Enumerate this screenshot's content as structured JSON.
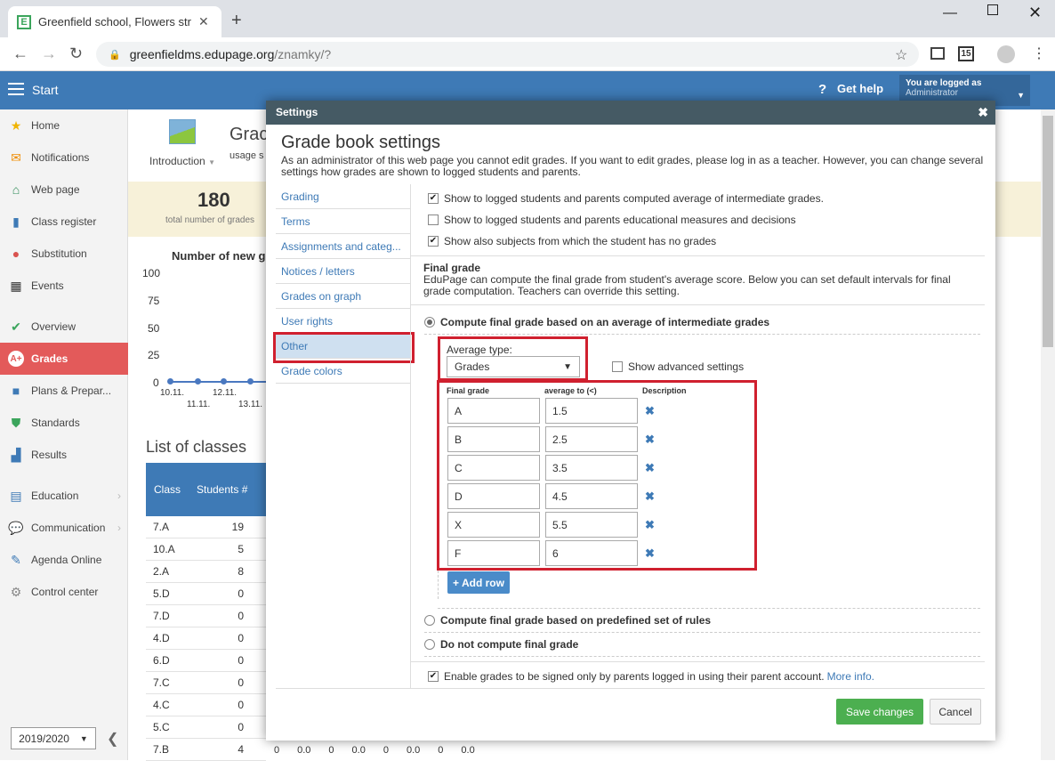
{
  "browser": {
    "tab_title": "Greenfield school, Flowers street",
    "favicon_letter": "E",
    "url_host": "greenfieldms.edupage.org",
    "url_path": "/znamky/?",
    "ext_badge": "15"
  },
  "header": {
    "start": "Start",
    "get_help": "Get help",
    "logged_as": "You are logged as",
    "user": "Administrator"
  },
  "sidebar": {
    "items": [
      {
        "label": "Home",
        "icon": "star-icon"
      },
      {
        "label": "Notifications",
        "icon": "envelope-icon"
      },
      {
        "label": "Web page",
        "icon": "house-icon"
      },
      {
        "label": "Class register",
        "icon": "book-icon"
      },
      {
        "label": "Substitution",
        "icon": "person-icon"
      },
      {
        "label": "Events",
        "icon": "calendar-icon"
      },
      {
        "label": "Overview",
        "icon": "check-icon"
      },
      {
        "label": "Grades",
        "icon": "grade-icon"
      },
      {
        "label": "Plans & Prepar...",
        "icon": "briefcase-icon"
      },
      {
        "label": "Standards",
        "icon": "shield-icon"
      },
      {
        "label": "Results",
        "icon": "bar-chart-icon"
      },
      {
        "label": "Education",
        "icon": "education-icon"
      },
      {
        "label": "Communication",
        "icon": "chat-icon"
      },
      {
        "label": "Agenda Online",
        "icon": "pencil-icon"
      },
      {
        "label": "Control center",
        "icon": "gear-icon"
      }
    ],
    "year": "2019/2020"
  },
  "background": {
    "intro_label": "Introduction",
    "page_title_partial": "Grac",
    "usage_partial": "usage s",
    "stat_value": "180",
    "stat_label": "total number of grades",
    "chart_title": "Number of new g",
    "y_ticks": [
      "100",
      "75",
      "50",
      "25",
      "0"
    ],
    "x_ticks": [
      "10.11.",
      "11.11.",
      "12.11.",
      "13.11."
    ],
    "classes_title": "List of classes",
    "class_col": "Class",
    "students_col": "Students #",
    "classes": [
      {
        "name": "7.A",
        "students": "19"
      },
      {
        "name": "10.A",
        "students": "5"
      },
      {
        "name": "2.A",
        "students": "8"
      },
      {
        "name": "5.D",
        "students": "0"
      },
      {
        "name": "7.D",
        "students": "0"
      },
      {
        "name": "4.D",
        "students": "0"
      },
      {
        "name": "6.D",
        "students": "0"
      },
      {
        "name": "7.C",
        "students": "0"
      },
      {
        "name": "4.C",
        "students": "0"
      },
      {
        "name": "5.C",
        "students": "0"
      },
      {
        "name": "7.B",
        "students": "4"
      }
    ],
    "last_row_extra": [
      "0",
      "0.0",
      "0",
      "0.0",
      "0",
      "0.0",
      "0",
      "0.0"
    ]
  },
  "modal": {
    "header": "Settings",
    "title": "Grade book settings",
    "description": "As an administrator of this web page you cannot edit grades. If you want to edit grades, please log in as a teacher. However, you can change several settings how grades are shown to logged students and parents.",
    "menu": [
      "Grading",
      "Terms",
      "Assignments and categ...",
      "Notices / letters",
      "Grades on graph",
      "User rights",
      "Other",
      "Grade colors"
    ],
    "checks": [
      {
        "label": "Show to logged students and parents computed average of intermediate grades.",
        "checked": true
      },
      {
        "label": "Show to logged students and parents educational measures and decisions",
        "checked": false
      },
      {
        "label": "Show also subjects from which the student has no grades",
        "checked": true
      }
    ],
    "final_grade_title": "Final grade",
    "final_grade_desc": "EduPage can compute the final grade from student's average score. Below you can set default intervals for final grade computation. Teachers can override this setting.",
    "option_average": "Compute final grade based on an average of intermediate grades",
    "avg_type_label": "Average type:",
    "avg_type_value": "Grades",
    "show_advanced": "Show advanced settings",
    "table_headers": [
      "Final grade",
      "average to (<)",
      "Description"
    ],
    "rows": [
      {
        "grade": "A",
        "avg": "1.5"
      },
      {
        "grade": "B",
        "avg": "2.5"
      },
      {
        "grade": "C",
        "avg": "3.5"
      },
      {
        "grade": "D",
        "avg": "4.5"
      },
      {
        "grade": "X",
        "avg": "5.5"
      },
      {
        "grade": "F",
        "avg": "6"
      }
    ],
    "add_row": "+ Add row",
    "option_rules": "Compute final grade based on predefined set of rules",
    "option_none": "Do not compute final grade",
    "sign_label": "Enable grades to be signed only by parents logged in using their parent account.",
    "more_info": "More info.",
    "save": "Save changes",
    "cancel": "Cancel"
  }
}
